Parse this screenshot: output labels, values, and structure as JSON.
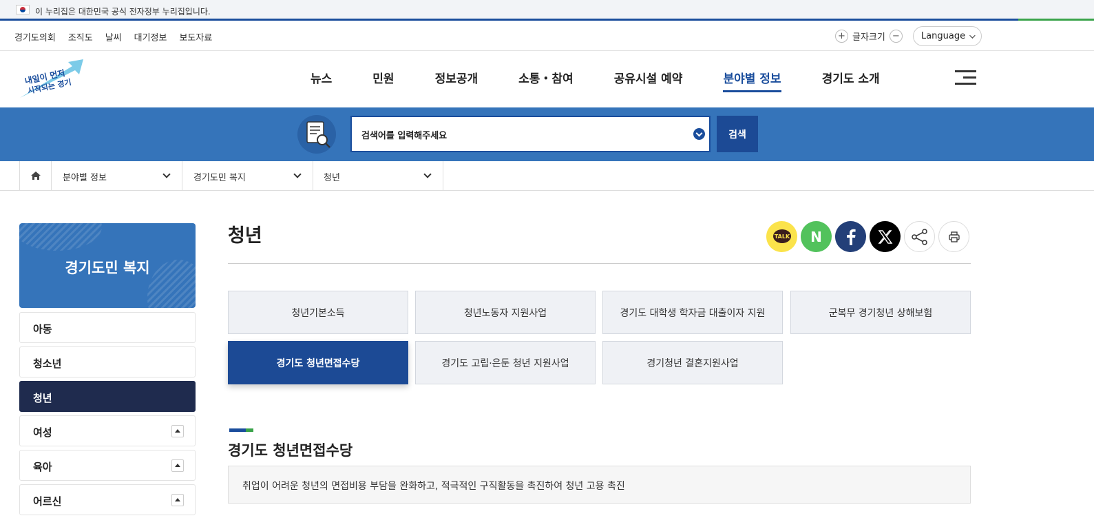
{
  "gov_banner": {
    "text": "이 누리집은 대한민국 공식 전자정부 누리집입니다."
  },
  "util": {
    "links": [
      "경기도의회",
      "조직도",
      "날씨",
      "대기정보",
      "보도자료"
    ],
    "font_size_label": "글자크기",
    "plus": "+",
    "minus": "−",
    "language": "Language"
  },
  "gnb": {
    "items": [
      "뉴스",
      "민원",
      "정보공개",
      "소통・참여",
      "공유시설 예약",
      "분야별 정보",
      "경기도 소개"
    ],
    "active_index": 5
  },
  "search": {
    "placeholder": "검색어를 입력해주세요",
    "button": "검색"
  },
  "breadcrumb": {
    "items": [
      "분야별 정보",
      "경기도민 복지",
      "청년"
    ]
  },
  "lnb": {
    "title": "경기도민 복지",
    "items": [
      {
        "label": "아동",
        "expandable": false,
        "active": false
      },
      {
        "label": "청소년",
        "expandable": false,
        "active": false
      },
      {
        "label": "청년",
        "expandable": false,
        "active": true
      },
      {
        "label": "여성",
        "expandable": true,
        "active": false
      },
      {
        "label": "육아",
        "expandable": true,
        "active": false
      },
      {
        "label": "어르신",
        "expandable": true,
        "active": false
      }
    ]
  },
  "page": {
    "title": "청년",
    "share": {
      "kakao_label": "TALK",
      "naver_label": "N"
    }
  },
  "tabs": {
    "items": [
      "청년기본소득",
      "청년노동자 지원사업",
      "경기도 대학생 학자금 대출이자 지원",
      "군복무 경기청년 상해보험",
      "경기도 청년면접수당",
      "경기도 고립·은둔 청년 지원사업",
      "경기청년 결혼지원사업"
    ],
    "active_index": 4
  },
  "section": {
    "title": "경기도 청년면접수당",
    "description": "취업이 어려운 청년의 면접비용 부담을 완화하고, 적극적인 구직활동을 촉진하여 청년 고용 촉진"
  },
  "colors": {
    "primary": "#1a4d9c",
    "search_band": "#3574ba",
    "active_nav": "#1f2b4e",
    "accent_green": "#3aa34a"
  }
}
